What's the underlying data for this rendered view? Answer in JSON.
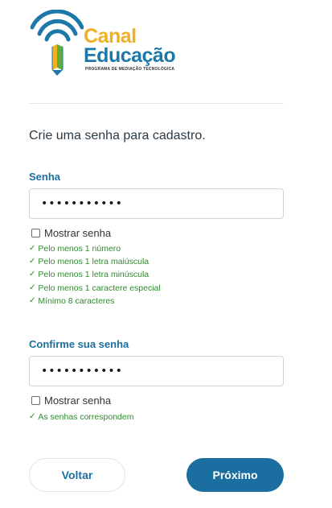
{
  "brand": {
    "word1": "Canal",
    "word2": "Educação",
    "tagline": "PROGRAMA DE MEDIAÇÃO TECNOLÓGICA",
    "icon": "wifi-book-logo",
    "colors": {
      "yellow": "#f0b022",
      "blue": "#1b78a8",
      "green": "#5fae3c"
    }
  },
  "form": {
    "intro": "Crie uma senha para cadastro.",
    "password": {
      "label": "Senha",
      "value": "•••••••••••",
      "show_label": "Mostrar senha",
      "show_checked": false,
      "rules": [
        {
          "icon": "check-icon",
          "text": "Pelo menos 1 número"
        },
        {
          "icon": "check-icon",
          "text": "Pelo menos 1 letra maiúscula"
        },
        {
          "icon": "check-icon",
          "text": "Pelo menos 1 letra minúscula"
        },
        {
          "icon": "check-icon",
          "text": "Pelo menos 1 caractere especial"
        },
        {
          "icon": "check-icon",
          "text": "Mínimo 8 caracteres"
        }
      ]
    },
    "confirm": {
      "label": "Confirme sua senha",
      "value": "•••••••••••",
      "show_label": "Mostrar senha",
      "show_checked": false,
      "rules": [
        {
          "icon": "check-icon",
          "text": "As senhas correspondem"
        }
      ]
    }
  },
  "actions": {
    "back_label": "Voltar",
    "next_label": "Próximo",
    "primary_color": "#1b6fa0"
  }
}
